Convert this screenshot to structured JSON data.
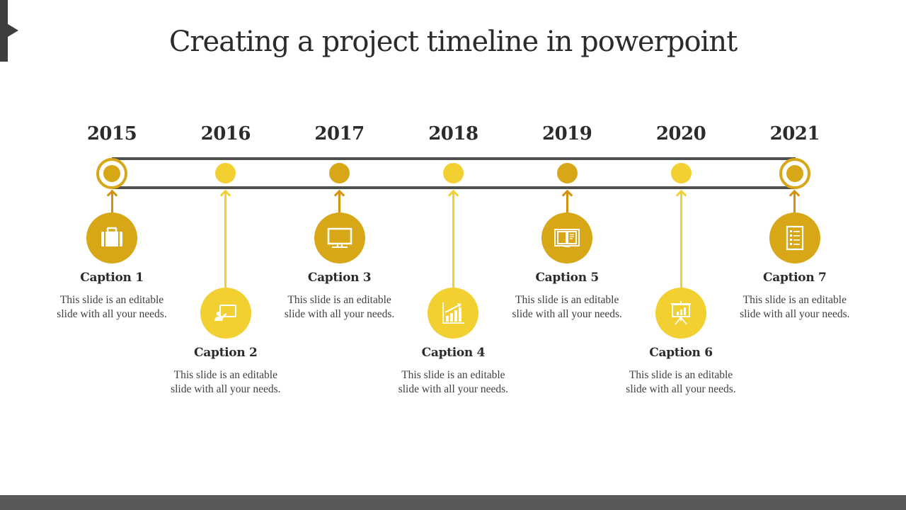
{
  "slide": {
    "title": "Creating a project timeline in powerpoint",
    "colors": {
      "dark_gold": "#d8a718",
      "light_gold": "#f3d032",
      "track": "#4f4f4f",
      "footer": "#595959",
      "corner": "#3e3e3e"
    }
  },
  "timeline": [
    {
      "year": "2015",
      "caption": "Caption 1",
      "text": "This slide is an editable slide with all your needs.",
      "icon": "briefcase-icon",
      "tone": "dark",
      "marker": "ring",
      "level": "upper"
    },
    {
      "year": "2016",
      "caption": "Caption 2",
      "text": "This slide is an editable slide with all your needs.",
      "icon": "presenter-board-icon",
      "tone": "light",
      "marker": "dot",
      "level": "lower"
    },
    {
      "year": "2017",
      "caption": "Caption 3",
      "text": "This slide is an editable slide with all your needs.",
      "icon": "monitor-icon",
      "tone": "dark",
      "marker": "dot",
      "level": "upper"
    },
    {
      "year": "2018",
      "caption": "Caption 4",
      "text": "This slide is an editable slide with all your needs.",
      "icon": "growth-chart-icon",
      "tone": "light",
      "marker": "dot",
      "level": "lower"
    },
    {
      "year": "2019",
      "caption": "Caption 5",
      "text": "This slide is an editable slide with all your needs.",
      "icon": "open-book-icon",
      "tone": "dark",
      "marker": "dot",
      "level": "upper"
    },
    {
      "year": "2020",
      "caption": "Caption 6",
      "text": "This slide is an editable slide with all your needs.",
      "icon": "presentation-easel-icon",
      "tone": "light",
      "marker": "dot",
      "level": "lower"
    },
    {
      "year": "2021",
      "caption": "Caption 7",
      "text": "This slide is an editable slide with all your needs.",
      "icon": "checklist-icon",
      "tone": "dark",
      "marker": "ring",
      "level": "upper"
    }
  ]
}
